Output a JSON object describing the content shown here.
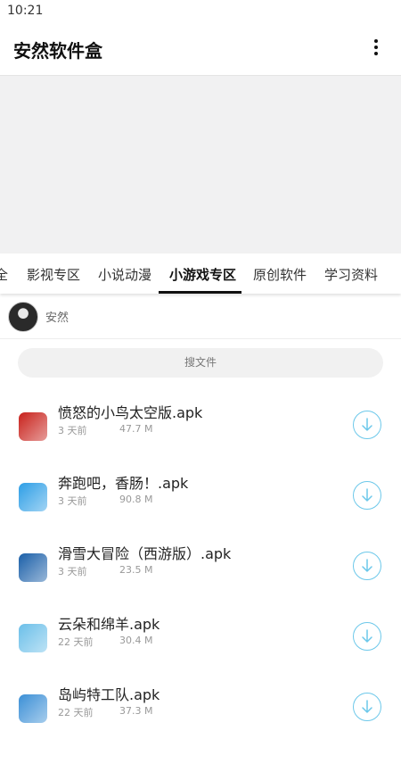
{
  "status_bar": {
    "time": "10:21"
  },
  "app_bar": {
    "title": "安然软件盒"
  },
  "tabs": [
    {
      "label": "全"
    },
    {
      "label": "影视专区"
    },
    {
      "label": "小说动漫"
    },
    {
      "label": "小游戏专区",
      "selected": true
    },
    {
      "label": "原创软件"
    },
    {
      "label": "学习资料"
    }
  ],
  "owner": {
    "name": "安然"
  },
  "search": {
    "placeholder": "搜文件"
  },
  "files": [
    {
      "name": "愤怒的小鸟太空版.apk",
      "time": "3 天前",
      "size": "47.7 M",
      "icon": "angry-birds-space-icon",
      "color": "#c8211b"
    },
    {
      "name": "奔跑吧，香肠！.apk",
      "time": "3 天前",
      "size": "90.8 M",
      "icon": "sausage-run-icon",
      "color": "#2d9ee6"
    },
    {
      "name": "滑雪大冒险（西游版）.apk",
      "time": "3 天前",
      "size": "23.5 M",
      "icon": "ski-safari-icon",
      "color": "#1a5fa8"
    },
    {
      "name": "云朵和绵羊.apk",
      "time": "22 天前",
      "size": "30.4 M",
      "icon": "clouds-sheep-icon",
      "color": "#6bbfe9"
    },
    {
      "name": "岛屿特工队.apk",
      "time": "22 天前",
      "size": "37.3 M",
      "icon": "island-agents-icon",
      "color": "#3b8fd6"
    }
  ],
  "colors": {
    "accent": "#6cc8ea",
    "tab_indicator": "#111111",
    "banner": "#f1f1f2"
  }
}
